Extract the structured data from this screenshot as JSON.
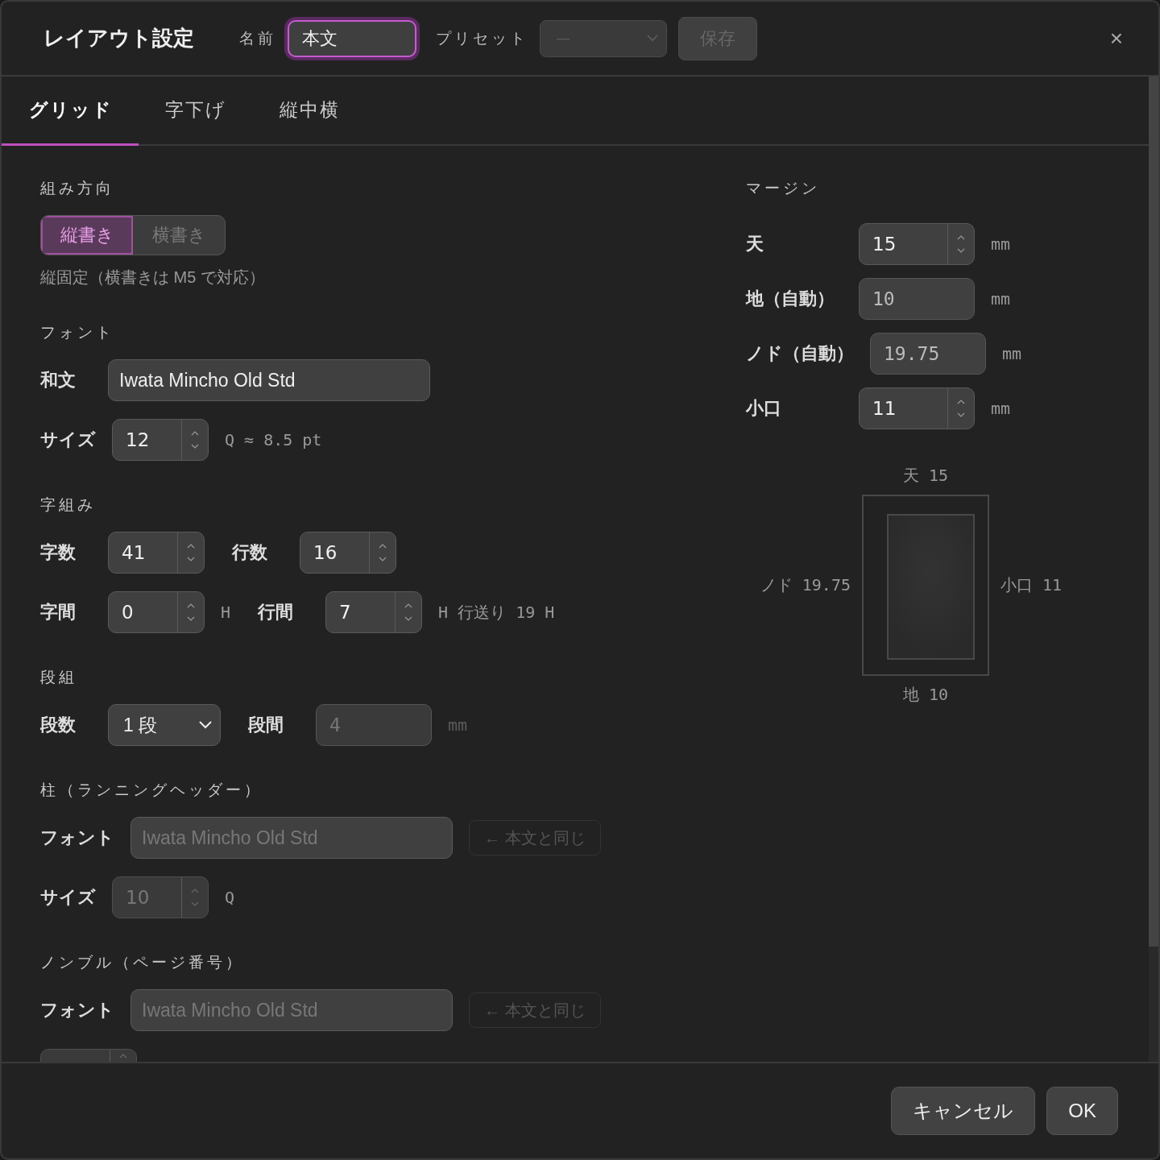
{
  "header": {
    "title": "レイアウト設定",
    "name_label": "名前",
    "name_value": "本文",
    "preset_label": "プリセット",
    "preset": {
      "value": "—",
      "disabled": true
    },
    "save": {
      "label": "保存",
      "disabled": true
    },
    "close": "×"
  },
  "tabs": [
    {
      "label": "グリッド",
      "selected": true
    },
    {
      "label": "字下げ",
      "selected": false
    },
    {
      "label": "縦中横",
      "selected": false
    }
  ],
  "sections": [
    {
      "heading": "組み方向",
      "rows": [
        {
          "items": [
            {
              "kind": "segmented",
              "options": [
                {
                  "label": "縦書き",
                  "selected": true
                },
                {
                  "label": "横書き",
                  "selected": false
                }
              ]
            }
          ]
        },
        {
          "items": [
            {
              "kind": "note",
              "text": "縦固定（横書きは M5 で対応）"
            }
          ]
        }
      ]
    },
    {
      "heading": "フォント",
      "rows": [
        {
          "items": [
            {
              "kind": "label",
              "text": "和文"
            },
            {
              "kind": "font-field",
              "value": "Iwata Mincho Old Std",
              "disabled": false
            }
          ]
        },
        {
          "items": [
            {
              "kind": "label",
              "text": "サイズ"
            },
            {
              "kind": "spinner",
              "value": "12",
              "disabled": false
            },
            {
              "kind": "unit",
              "text": "Q ≈ 8.5 pt",
              "disabled": false
            }
          ]
        }
      ]
    },
    {
      "heading": "字組み",
      "rows": [
        {
          "items": [
            {
              "kind": "label",
              "text": "字数"
            },
            {
              "kind": "spinner",
              "value": "41",
              "disabled": false
            },
            {
              "kind": "label",
              "text": "行数"
            },
            {
              "kind": "spinner",
              "value": "16",
              "disabled": false
            }
          ]
        },
        {
          "items": [
            {
              "kind": "label",
              "text": "字間"
            },
            {
              "kind": "spinner",
              "value": "0",
              "disabled": false
            },
            {
              "kind": "unit",
              "text": "H",
              "disabled": false
            },
            {
              "kind": "label",
              "text": "行間"
            },
            {
              "kind": "spinner",
              "value": "7",
              "disabled": false
            },
            {
              "kind": "unit",
              "text": "H 行送り 19 H",
              "disabled": false
            }
          ]
        }
      ]
    },
    {
      "heading": "段組",
      "rows": [
        {
          "items": [
            {
              "kind": "label",
              "text": "段数"
            },
            {
              "kind": "select",
              "value": "1 段",
              "disabled": false
            },
            {
              "kind": "label",
              "text": "段間"
            },
            {
              "kind": "field",
              "value": "4",
              "disabled": true
            },
            {
              "kind": "unit",
              "text": "mm",
              "disabled": true
            }
          ]
        }
      ]
    },
    {
      "heading": "柱（ランニングヘッダー）",
      "rows": [
        {
          "items": [
            {
              "kind": "label",
              "text": "フォント"
            },
            {
              "kind": "font-field",
              "value": "Iwata Mincho Old Std",
              "disabled": true
            },
            {
              "kind": "button",
              "label": "← 本文と同じ",
              "disabled": true
            }
          ]
        },
        {
          "items": [
            {
              "kind": "label",
              "text": "サイズ"
            },
            {
              "kind": "spinner",
              "value": "10",
              "disabled": true
            },
            {
              "kind": "unit",
              "text": "Q",
              "disabled": false
            }
          ]
        }
      ]
    },
    {
      "heading": "ノンブル（ページ番号）",
      "rows": [
        {
          "items": [
            {
              "kind": "label",
              "text": "フォント"
            },
            {
              "kind": "font-field",
              "value": "Iwata Mincho Old Std",
              "disabled": true
            },
            {
              "kind": "button",
              "label": "← 本文と同じ",
              "disabled": true
            }
          ]
        },
        {
          "items": [
            {
              "kind": "spinner",
              "disabled": true
            }
          ]
        }
      ]
    }
  ],
  "margins": {
    "heading": "マージン",
    "rows": [
      {
        "label": "天",
        "value": "15",
        "kind": "spinner",
        "unit": "mm"
      },
      {
        "label": "地（自動）",
        "value": "10",
        "kind": "field",
        "unit": "mm"
      },
      {
        "label": "ノド（自動）",
        "value": "19.75",
        "kind": "field",
        "unit": "mm"
      },
      {
        "label": "小口",
        "value": "11",
        "kind": "spinner",
        "unit": "mm"
      }
    ],
    "diagram": {
      "top": "天 15",
      "left": "ノド 19.75",
      "right": "小口 11",
      "bottom": "地 10"
    }
  },
  "footer": {
    "buttons": [
      {
        "label": "キャンセル"
      },
      {
        "label": "OK"
      }
    ]
  }
}
